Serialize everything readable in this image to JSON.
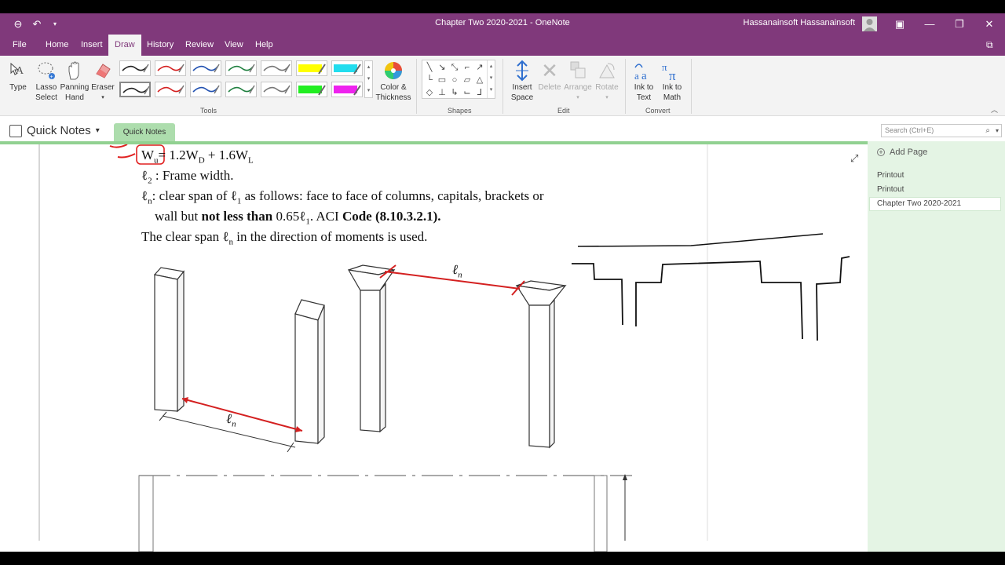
{
  "titlebar": {
    "title": "Chapter Two 2020-2021  -  OneNote",
    "user": "Hassanainsoft Hassanainsoft"
  },
  "menu": {
    "tabs": [
      "File",
      "Home",
      "Insert",
      "Draw",
      "History",
      "Review",
      "View",
      "Help"
    ],
    "active": "Draw"
  },
  "ribbon": {
    "type_label": "Type",
    "lasso_label": "Lasso Select",
    "panning_label": "Panning Hand",
    "eraser_label": "Eraser",
    "color_thickness_label": "Color & Thickness",
    "tools_group": "Tools",
    "shapes_group": "Shapes",
    "insert_space_label": "Insert Space",
    "delete_label": "Delete",
    "arrange_label": "Arrange",
    "rotate_label": "Rotate",
    "edit_group": "Edit",
    "ink_to_text_label": "Ink to Text",
    "ink_to_math_label": "Ink to Math",
    "convert_group": "Convert",
    "pen_colors": [
      "#222222",
      "#d42020",
      "#2050b0",
      "#208040",
      "#777777",
      "#ffff00",
      "#22ddee",
      "#222222",
      "#d42020",
      "#2050b0",
      "#208040",
      "#777777",
      "#22ee22",
      "#ee22ee"
    ]
  },
  "notebook": {
    "name": "Quick Notes",
    "section": "Quick Notes",
    "search_placeholder": "Search (Ctrl+E)"
  },
  "pages": {
    "add_label": "Add Page",
    "items": [
      "Printout",
      "Printout",
      "Chapter Two 2020-2021"
    ]
  },
  "content": {
    "line1_formula": "= 1.2W",
    "line1_wu": "W",
    "line1_wu_sub": "u",
    "line1_d": "D",
    "line1_plus": " + 1.6W",
    "line1_l": "L",
    "line2": "ℓ",
    "line2_sub": "2",
    "line2_rest": " : Frame width.",
    "line3_a": "ℓ",
    "line3_a_sub": "n",
    "line3_b": ": clear span of ℓ",
    "line3_b_sub": "1",
    "line3_c": " as follows: face to face of columns, capitals, brackets or",
    "line4_a": "wall but ",
    "line4_b": "not less than",
    "line4_c": " 0.65ℓ",
    "line4_c_sub": "1",
    "line4_d": ". ACI ",
    "line4_e": "Code (8.10.3.2.1).",
    "line5_a": "The clear span ℓ",
    "line5_a_sub": "n",
    "line5_b": " in the direction of moments is used.",
    "fig_label_left": "ℓ",
    "fig_label_left_sub": "n",
    "fig_label_right": "ℓ",
    "fig_label_right_sub": "n"
  }
}
